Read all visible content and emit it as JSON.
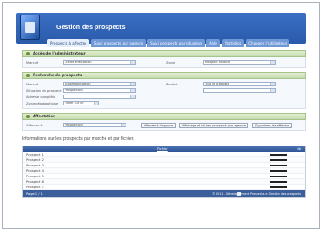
{
  "header": {
    "title": "Gestion des prospects"
  },
  "tabs": [
    {
      "label": "Prospects à affecter",
      "active": true
    },
    {
      "label": "Suivi prospects par agence",
      "active": false
    },
    {
      "label": "Suivi prospects par situation",
      "active": false
    },
    {
      "label": "Aide",
      "active": false
    },
    {
      "label": "Statistics",
      "active": false
    },
    {
      "label": "Changer d'utilisateur",
      "active": false
    }
  ],
  "section1": {
    "title": "Accès de l'administrateur",
    "field1_label": "Marché",
    "field1_value": "Crédit affectation",
    "field2_label": "Zone",
    "field2_value": "Prospect finance"
  },
  "section2": {
    "title": "Recherche de prospects",
    "rows": [
      {
        "label": "Marché",
        "value": "Automobilisation",
        "label2": "Produit",
        "value2": "Tout le prospect"
      },
      {
        "label": "Situation du prospect",
        "value": "Prospection",
        "label2": "",
        "value2": ""
      },
      {
        "label": "Adresse complète",
        "value": "",
        "label2": "",
        "value2": ""
      },
      {
        "label": "Zone géographique",
        "value": "Filtrer sur N°",
        "label2": "",
        "value2": ""
      }
    ]
  },
  "section3": {
    "title": "Affectation",
    "label": "Affecter à",
    "value": "Prospection",
    "btn1": "Affecter à l'agence",
    "btn2": "Affichage et tri des prospects par agence",
    "btn3": "Supprimer les affectés"
  },
  "info_text": "Informations sur les prospects par marché et par fichier.",
  "table": {
    "col1": "Fichier",
    "col2": "Nb",
    "rows": [
      "Prospect 1",
      "Prospect 2",
      "Prospect 3",
      "Prospect 4",
      "Prospect 5",
      "Prospect 6",
      "Prospect 7"
    ],
    "footer_left": "Page 1 / 1",
    "footer_right": "© 2011 - Développement Prospects et Gestion des prospects"
  }
}
